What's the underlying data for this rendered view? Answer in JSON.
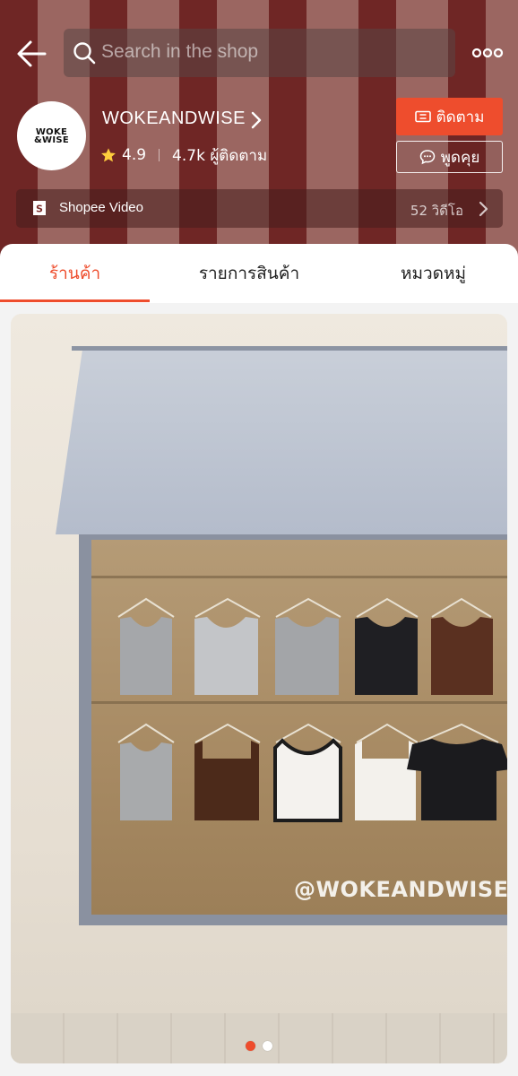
{
  "topbar": {
    "search_placeholder": "Search in the shop",
    "back_icon": "arrow-left-icon",
    "more_icon": "more-dots-icon"
  },
  "shop": {
    "logo_text": "WOKE\nWISE",
    "name": "WOKEANDWISE",
    "rating": "4.9",
    "followers": "4.7k ผู้ติดตาม"
  },
  "actions": {
    "follow_label": "ติดตาม",
    "chat_label": "พูดคุย"
  },
  "video_bar": {
    "label": "Shopee Video",
    "count": "52 วิดีโอ"
  },
  "tabs": [
    {
      "label": "ร้านค้า",
      "active": true
    },
    {
      "label": "รายการสินค้า",
      "active": false
    },
    {
      "label": "หมวดหมู่",
      "active": false
    }
  ],
  "banner": {
    "watermark": "@WOKEANDWISE.CO",
    "slide_index": 1,
    "slide_count": 2
  },
  "colors": {
    "accent": "#ee4d2d",
    "header_dark": "#7b2d2b",
    "header_light": "#b07a74"
  }
}
